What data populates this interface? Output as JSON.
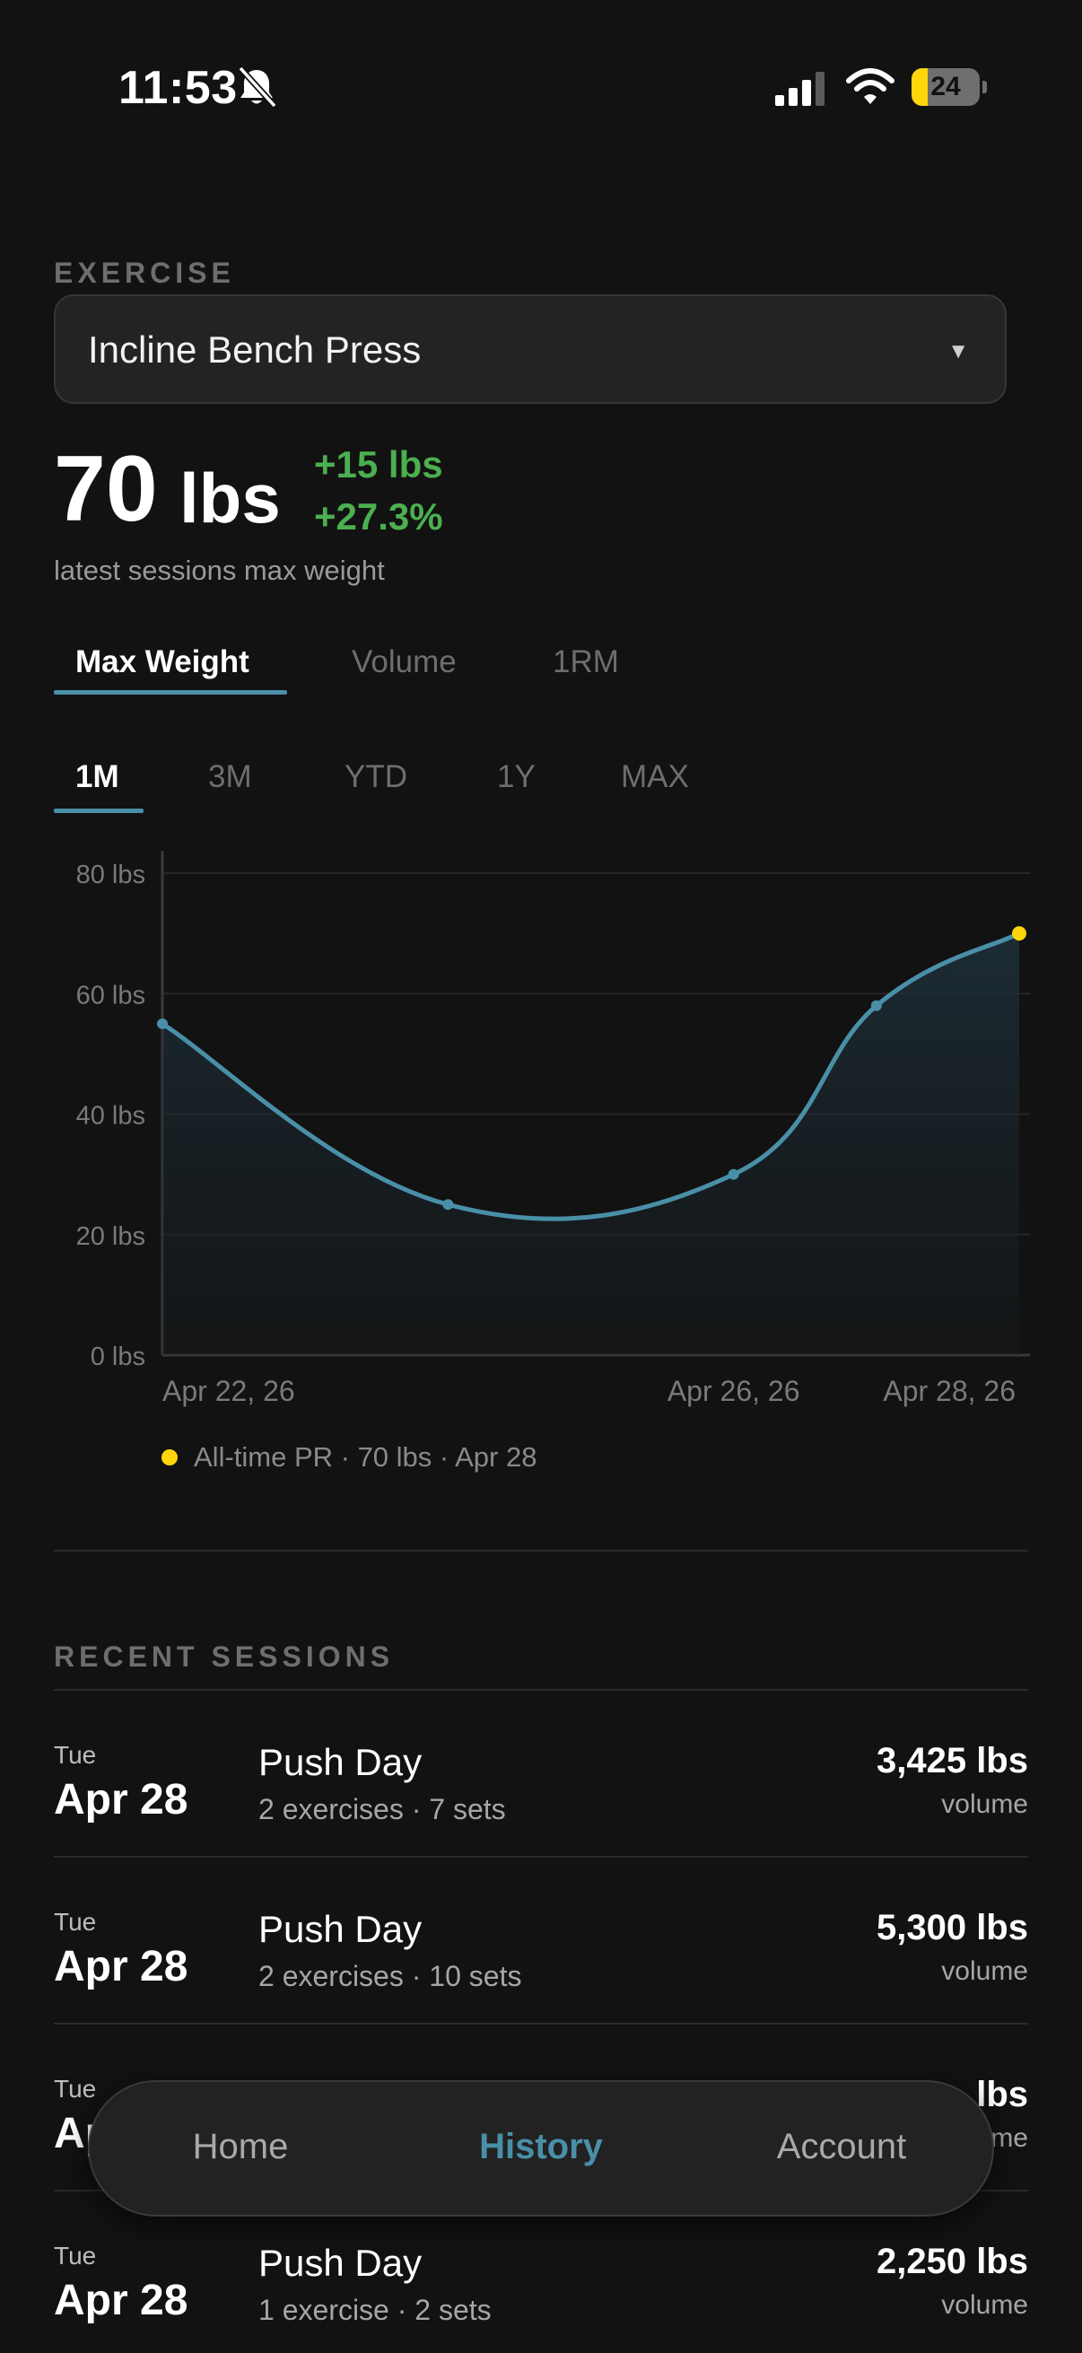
{
  "status_bar": {
    "time": "11:53",
    "battery_percent": "24",
    "battery_level": 0.24,
    "icons": [
      "bell-slash-icon",
      "cellular-signal-icon",
      "wifi-icon",
      "battery-icon"
    ]
  },
  "exercise": {
    "section_label": "EXERCISE",
    "selected": "Incline Bench Press",
    "dropdown_icon": "▼"
  },
  "summary": {
    "value": "70",
    "unit": "lbs",
    "delta_abs": "+15 lbs",
    "delta_pct": "+27.3%",
    "caption": "latest sessions max weight",
    "accent_positive": "#4caf50"
  },
  "metric_tabs": [
    {
      "label": "Max Weight",
      "active": true
    },
    {
      "label": "Volume",
      "active": false
    },
    {
      "label": "1RM",
      "active": false
    }
  ],
  "range_tabs": [
    {
      "label": "1M",
      "active": true
    },
    {
      "label": "3M",
      "active": false
    },
    {
      "label": "YTD",
      "active": false
    },
    {
      "label": "1Y",
      "active": false
    },
    {
      "label": "MAX",
      "active": false
    }
  ],
  "chart_data": {
    "type": "area",
    "series": [
      {
        "x": [
          "Apr 22, 26",
          "Apr 24, 26",
          "Apr 26, 26",
          "Apr 27, 26",
          "Apr 28, 26"
        ],
        "values": [
          55,
          25,
          30,
          58,
          70
        ]
      }
    ],
    "x_tick_labels": [
      "Apr 22, 26",
      "Apr 26, 26",
      "Apr 28, 26"
    ],
    "y_tick_labels": [
      "80 lbs",
      "60 lbs",
      "40 lbs",
      "20 lbs",
      "0 lbs"
    ],
    "ylim": [
      0,
      80
    ],
    "grid": true,
    "line_color": "#4a8fa8",
    "highlight_color": "#ffd60a",
    "highlight_last_point": true
  },
  "pr_note": "All-time PR · 70 lbs · Apr 28",
  "recent_sessions": {
    "section_label": "RECENT SESSIONS",
    "items": [
      {
        "day": "Tue",
        "date": "Apr 28",
        "name": "Push Day",
        "meta": "2 exercises · 7 sets",
        "volume": "3,425 lbs",
        "volume_label": "volume"
      },
      {
        "day": "Tue",
        "date": "Apr 28",
        "name": "Push Day",
        "meta": "2 exercises · 10 sets",
        "volume": "5,300 lbs",
        "volume_label": "volume"
      },
      {
        "day": "Tue",
        "date": "Ap",
        "name": "",
        "meta": "",
        "volume": "lbs",
        "volume_label": "me"
      },
      {
        "day": "Tue",
        "date": "Apr 28",
        "name": "Push Day",
        "meta": "1 exercise · 2 sets",
        "volume": "2,250 lbs",
        "volume_label": "volume"
      }
    ]
  },
  "bottom_nav": [
    {
      "label": "Home",
      "active": false
    },
    {
      "label": "History",
      "active": true
    },
    {
      "label": "Account",
      "active": false
    }
  ]
}
